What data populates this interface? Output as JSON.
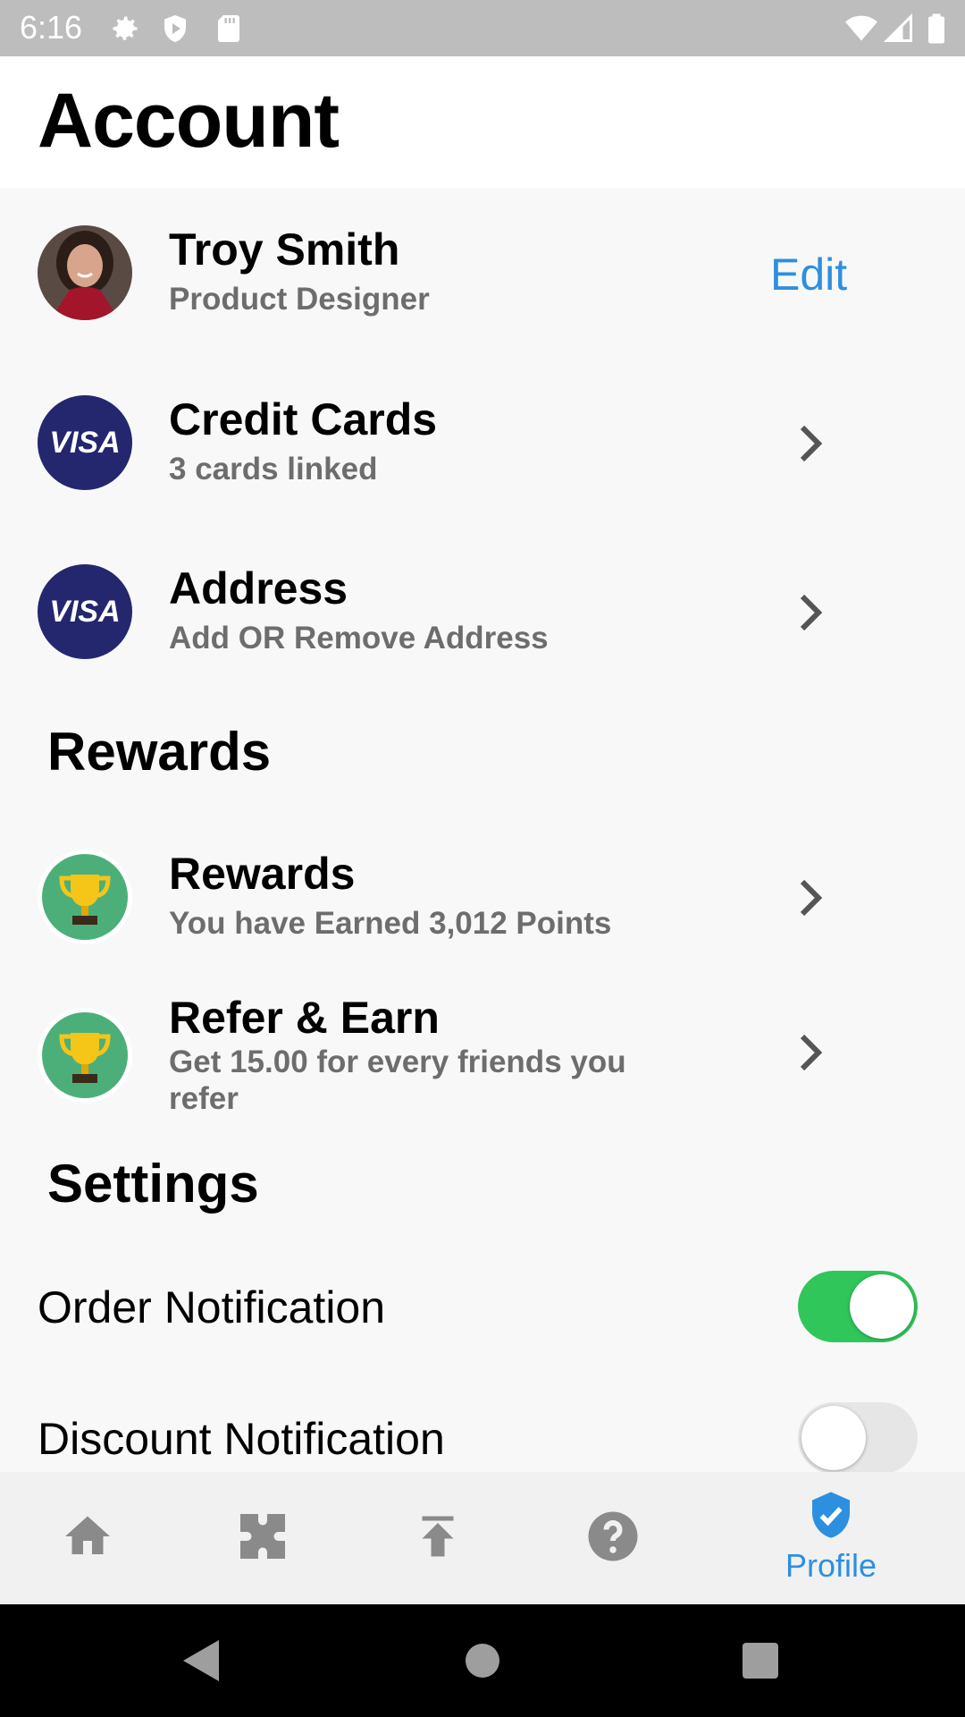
{
  "status_bar": {
    "time": "6:16",
    "icons": [
      "gear-icon",
      "shield-icon",
      "sd-card-icon",
      "wifi-icon",
      "signal-icon",
      "battery-icon"
    ]
  },
  "header": {
    "title": "Account"
  },
  "profile": {
    "name": "Troy Smith",
    "role": "Product Designer",
    "edit_label": "Edit"
  },
  "account_items": [
    {
      "title": "Credit Cards",
      "subtitle": "3 cards linked",
      "icon": "visa-icon"
    },
    {
      "title": "Address",
      "subtitle": "Add OR Remove Address",
      "icon": "visa-icon"
    }
  ],
  "rewards_section": {
    "title": "Rewards",
    "items": [
      {
        "title": "Rewards",
        "subtitle": "You have Earned 3,012 Points",
        "icon": "trophy-icon"
      },
      {
        "title": "Refer & Earn",
        "subtitle": "Get 15.00 for every friends you refer",
        "icon": "trophy-icon"
      }
    ]
  },
  "settings_section": {
    "title": "Settings",
    "items": [
      {
        "label": "Order Notification",
        "enabled": true
      },
      {
        "label": "Discount Notification",
        "enabled": false
      }
    ]
  },
  "tab_bar": {
    "tabs": [
      {
        "icon": "home-icon",
        "label": ""
      },
      {
        "icon": "puzzle-icon",
        "label": ""
      },
      {
        "icon": "upload-icon",
        "label": ""
      },
      {
        "icon": "help-icon",
        "label": ""
      },
      {
        "icon": "shield-check-icon",
        "label": "Profile",
        "active": true
      }
    ]
  },
  "colors": {
    "accent": "#2d8fe0",
    "toggle_on": "#31c65a",
    "toggle_off": "#e6e6e6",
    "visa_navy": "#24276e",
    "trophy_green": "#4caf7a",
    "subtitle_gray": "#6d6d6d"
  }
}
